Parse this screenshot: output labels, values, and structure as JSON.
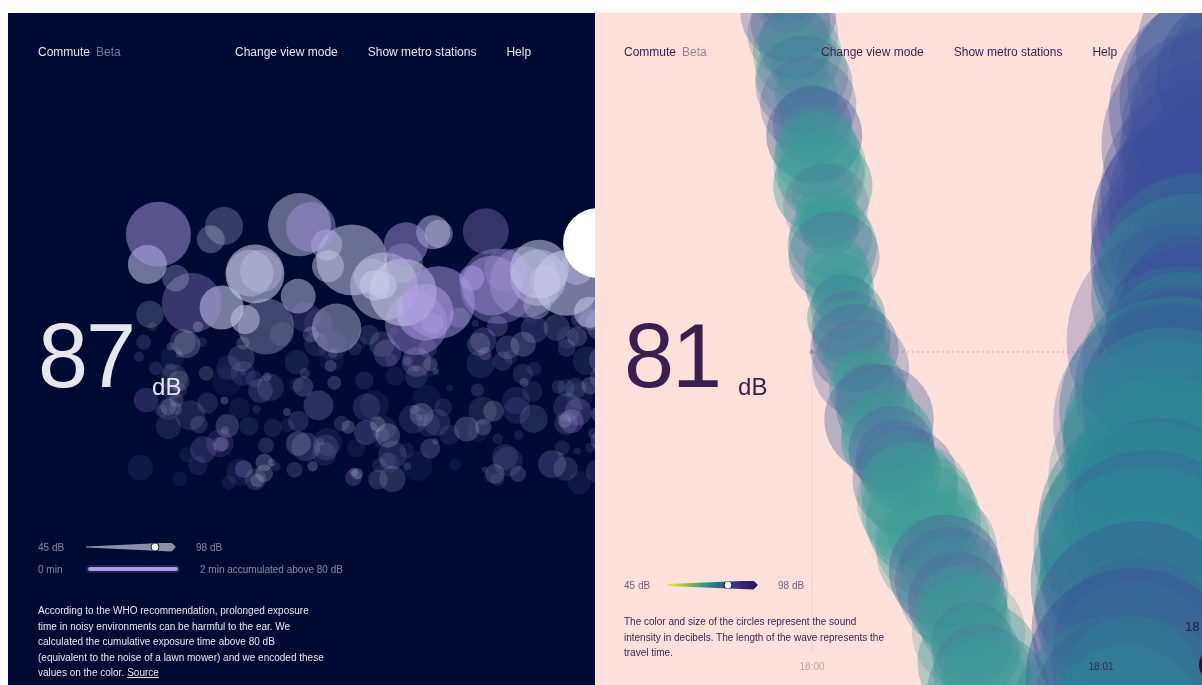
{
  "panels": [
    {
      "kind": "dark",
      "brand": "Commute",
      "badge": "Beta",
      "nav": [
        "Change view mode",
        "Show metro stations",
        "Help"
      ],
      "reading": "87",
      "unit": "dB",
      "volume": {
        "min": "45 dB",
        "max": "98 dB",
        "level": 0.77
      },
      "exposure": {
        "min": "0 min",
        "caption": "2 min accumulated above 80 dB",
        "level": 1
      },
      "note": "According to the WHO recommendation, prolonged exposure time in noisy environments can be harmful to the ear. We calculated the cumulative exposure time above 80 dB (equivalent to the noise of a lawn mower) and we encoded these values on the color.",
      "link": "Source"
    },
    {
      "kind": "light",
      "brand": "Commute",
      "badge": "Beta",
      "nav": [
        "Change view mode",
        "Show metro stations",
        "Help"
      ],
      "reading": "81",
      "unit": "dB",
      "volume": {
        "min": "45 dB",
        "max": "98 dB",
        "level": 0.67
      },
      "note": "The color and size of the circles represent the sound intensity in decibels. The length of the wave represents the travel time.",
      "times": [
        "18:00",
        "18:01",
        "18"
      ]
    }
  ]
}
